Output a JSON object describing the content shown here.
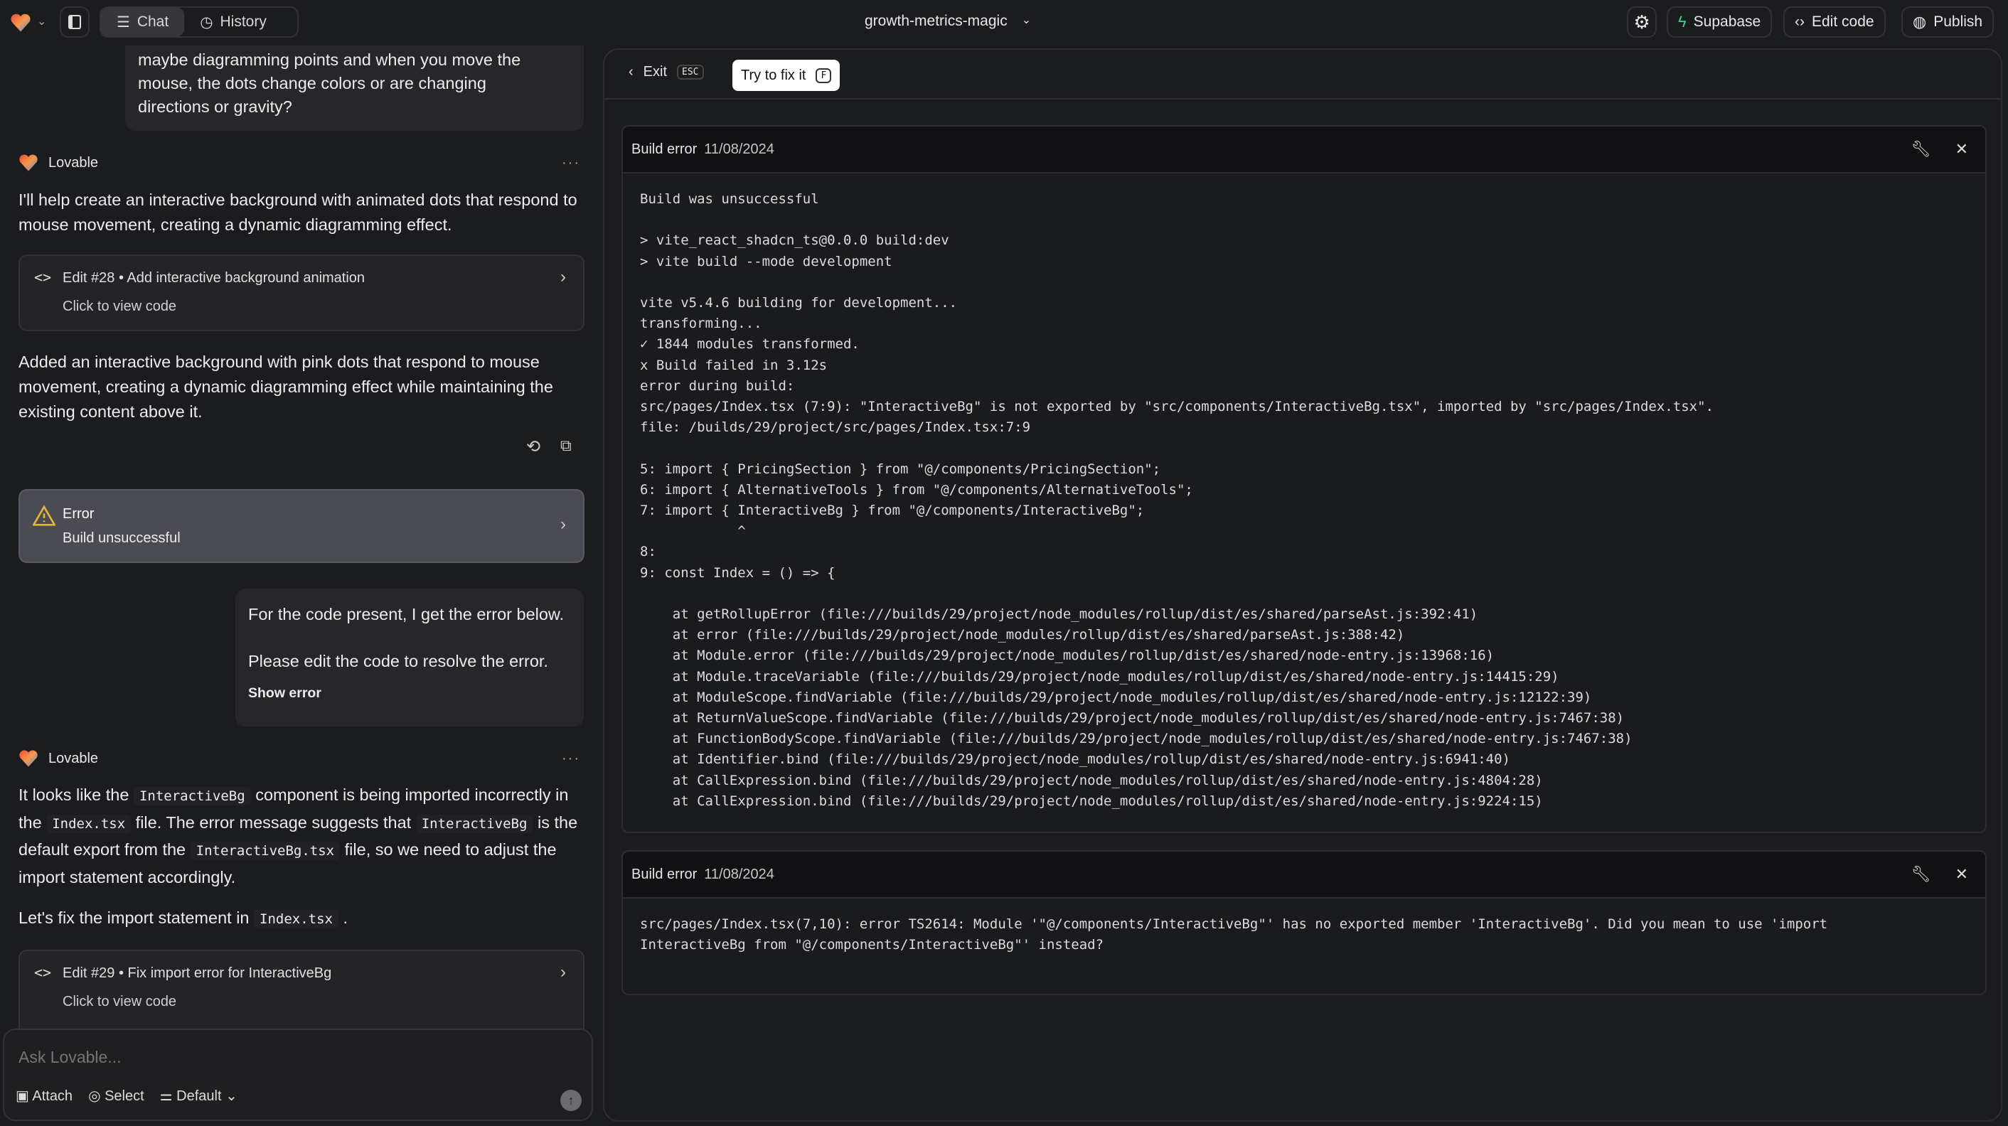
{
  "topbar": {
    "chat_tab": "Chat",
    "history_tab": "History",
    "project_name": "growth-metrics-magic",
    "supabase": "Supabase",
    "edit_code": "Edit code",
    "publish": "Publish",
    "colors": {
      "supabase": "#3ecf8e"
    }
  },
  "chat": {
    "user_msg_1": [
      "maybe diagramming points and when you move the",
      "mouse, the dots change colors or are changing",
      "directions or gravity?"
    ],
    "assistant_name": "Lovable",
    "assistant_1": "I'll help create an interactive background with animated dots that respond to mouse movement, creating a dynamic diagramming effect.",
    "edit_28": {
      "title": "Edit #28 • Add interactive background animation",
      "subtitle": "Click to view code"
    },
    "assistant_1b": "Added an interactive background with pink dots that respond to mouse movement, creating a dynamic diagramming effect while maintaining the existing content above it.",
    "error_card": {
      "title": "Error",
      "subtitle": "Build unsuccessful",
      "warning_color": "#e5b53a"
    },
    "user_msg_2": {
      "line1": "For the code present, I get the error below.",
      "line2": "Please edit the code to resolve the error.",
      "show_error": "Show error"
    },
    "assistant_2": [
      {
        "t": "It looks like the "
      },
      {
        "c": "InteractiveBg"
      },
      {
        "t": " component is being imported incorrectly in the "
      },
      {
        "c": "Index.tsx"
      },
      {
        "t": " file. The error message suggests that "
      },
      {
        "c": "InteractiveBg"
      },
      {
        "t": " is the default export from the "
      },
      {
        "c": "InteractiveBg.tsx"
      },
      {
        "t": " file, so we need to adjust the import statement accordingly."
      }
    ],
    "assistant_2b": [
      {
        "t": "Let's fix the import statement in "
      },
      {
        "c": "Index.tsx"
      },
      {
        "t": " ."
      }
    ],
    "edit_29": {
      "title": "Edit #29 • Fix import error for InteractiveBg",
      "subtitle": "Click to view code"
    },
    "input": {
      "placeholder": "Ask Lovable...",
      "attach": "Attach",
      "select": "Select",
      "mode": "Default"
    }
  },
  "panel": {
    "exit": "Exit",
    "esc": "ESC",
    "try_fix": "Try to fix it",
    "try_fix_key": "F",
    "errors": [
      {
        "title": "Build error",
        "date": "11/08/2024",
        "lines": [
          "Build was unsuccessful",
          "",
          "> vite_react_shadcn_ts@0.0.0 build:dev",
          "> vite build --mode development",
          "",
          "vite v5.4.6 building for development...",
          "transforming...",
          "✓ 1844 modules transformed.",
          "x Build failed in 3.12s",
          "error during build:",
          "src/pages/Index.tsx (7:9): \"InteractiveBg\" is not exported by \"src/components/InteractiveBg.tsx\", imported by \"src/pages/Index.tsx\".",
          "file: /builds/29/project/src/pages/Index.tsx:7:9",
          "",
          "5: import { PricingSection } from \"@/components/PricingSection\";",
          "6: import { AlternativeTools } from \"@/components/AlternativeTools\";",
          "7: import { InteractiveBg } from \"@/components/InteractiveBg\";",
          "            ^",
          "8:",
          "9: const Index = () => {",
          "",
          "    at getRollupError (file:///builds/29/project/node_modules/rollup/dist/es/shared/parseAst.js:392:41)",
          "    at error (file:///builds/29/project/node_modules/rollup/dist/es/shared/parseAst.js:388:42)",
          "    at Module.error (file:///builds/29/project/node_modules/rollup/dist/es/shared/node-entry.js:13968:16)",
          "    at Module.traceVariable (file:///builds/29/project/node_modules/rollup/dist/es/shared/node-entry.js:14415:29)",
          "    at ModuleScope.findVariable (file:///builds/29/project/node_modules/rollup/dist/es/shared/node-entry.js:12122:39)",
          "    at ReturnValueScope.findVariable (file:///builds/29/project/node_modules/rollup/dist/es/shared/node-entry.js:7467:38)",
          "    at FunctionBodyScope.findVariable (file:///builds/29/project/node_modules/rollup/dist/es/shared/node-entry.js:7467:38)",
          "    at Identifier.bind (file:///builds/29/project/node_modules/rollup/dist/es/shared/node-entry.js:6941:40)",
          "    at CallExpression.bind (file:///builds/29/project/node_modules/rollup/dist/es/shared/node-entry.js:4804:28)",
          "    at CallExpression.bind (file:///builds/29/project/node_modules/rollup/dist/es/shared/node-entry.js:9224:15)"
        ]
      },
      {
        "title": "Build error",
        "date": "11/08/2024",
        "lines": [
          "src/pages/Index.tsx(7,10): error TS2614: Module '\"@/components/InteractiveBg\"' has no exported member 'InteractiveBg'. Did you mean to use 'import",
          "InteractiveBg from \"@/components/InteractiveBg\"' instead?"
        ]
      }
    ]
  }
}
